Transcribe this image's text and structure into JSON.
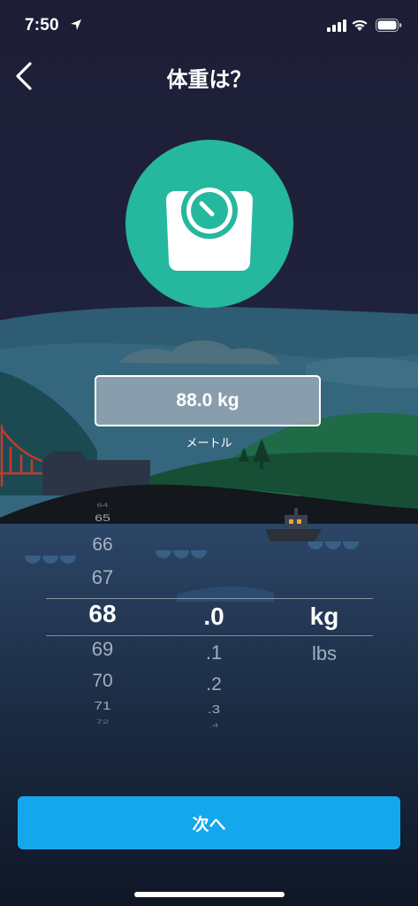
{
  "status_bar": {
    "time": "7:50"
  },
  "header": {
    "title": "体重は？"
  },
  "weight_display": {
    "value": "88.0 kg",
    "unit_label": "メートル"
  },
  "picker": {
    "integers": [
      "64",
      "65",
      "66",
      "67",
      "68",
      "69",
      "70",
      "71",
      "72"
    ],
    "selected_integer": "68",
    "decimals": [
      ".0",
      ".1",
      ".2",
      ".3",
      ".4"
    ],
    "selected_decimal": ".0",
    "units": [
      "kg",
      "lbs"
    ],
    "selected_unit": "kg"
  },
  "next_button": {
    "label": "次へ"
  },
  "colors": {
    "accent": "#15a7ec",
    "icon_circle": "#26b79f",
    "background": "#1f2038"
  }
}
